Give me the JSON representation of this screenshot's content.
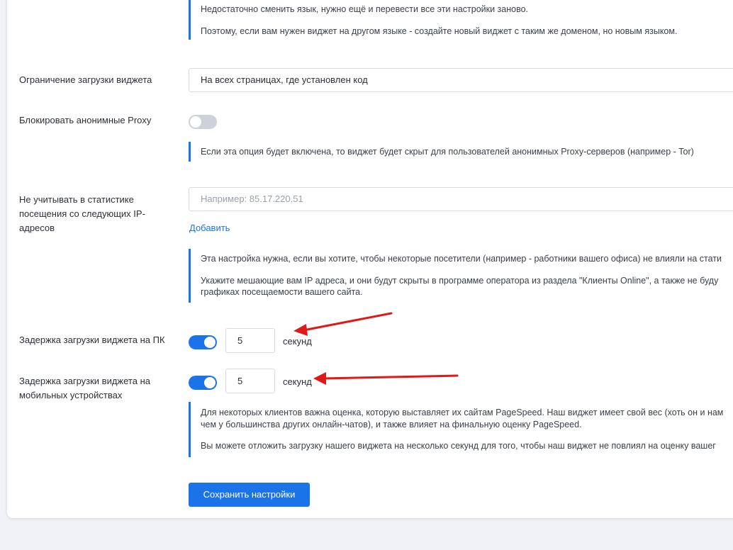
{
  "top_note": {
    "line1": "Недостаточно сменить язык, нужно ещё и перевести все эти настройки заново.",
    "line2": "Поэтому, если вам нужен виджет на другом языке - создайте новый виджет с таким же доменом, но новым языком."
  },
  "load_restriction": {
    "label": "Ограничение загрузки виджета",
    "value": "На всех страницах, где установлен код"
  },
  "proxy": {
    "label": "Блокировать анонимные Proxy",
    "enabled": false,
    "note": "Если эта опция будет включена, то виджет будет скрыт для пользователей анонимных Proxy-серверов (например - Tor)"
  },
  "ip_exclude": {
    "label_line1": "Не учитывать в статистике",
    "label_line2": "посещения со следующих IP-адресов",
    "placeholder": "Например: 85.17.220.51",
    "add_link": "Добавить",
    "note_line1": "Эта настройка нужна, если вы хотите, чтобы некоторые посетители (например - работники вашего офиса) не влияли на стати",
    "note_line2": "Укажите мешающие вам IP адреса, и они будут скрыты в программе оператора из раздела \"Клиенты Online\", а также не буду",
    "note_line3": "графиках посещаемости вашего сайта."
  },
  "delay_pc": {
    "label": "Задержка загрузки виджета на ПК",
    "enabled": true,
    "value": "5",
    "unit": "секунд"
  },
  "delay_mobile": {
    "label_line1": "Задержка загрузки виджета на",
    "label_line2": "мобильных устройствах",
    "enabled": true,
    "value": "5",
    "unit": "секунд"
  },
  "pagespeed_note": {
    "line1": "Для некоторых клиентов важна оценка, которую выставляет их сайтам PageSpeed. Наш виджет имеет свой вес (хоть он и нам",
    "line2": "чем у большинства других онлайн-чатов), и также влияет на финальную оценку PageSpeed.",
    "line3": "Вы можете отложить загрузку нашего виджета на несколько секунд для того, чтобы наш виджет не повлиял на оценку вашег"
  },
  "save_button": "Сохранить настройки",
  "colors": {
    "accent": "#1a73e8",
    "annotation_arrow": "#e01818"
  }
}
